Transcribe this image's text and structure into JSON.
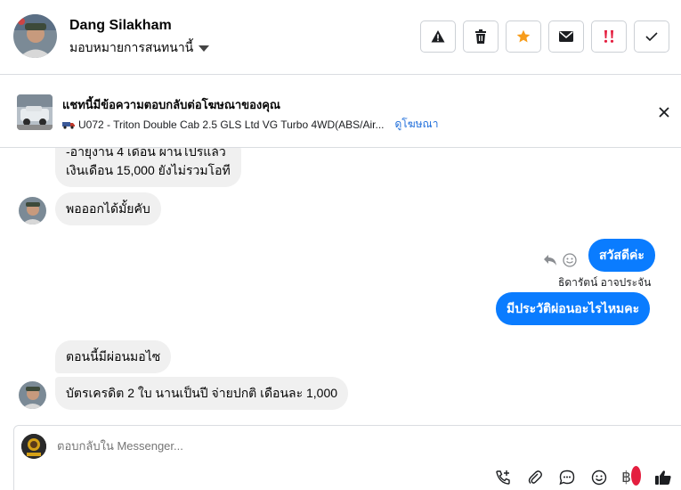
{
  "header": {
    "contact_name": "Dang Silakham",
    "assign_label": "มอบหมายการสนทนานี้",
    "tools": [
      "warning-icon",
      "trash-icon",
      "star-icon",
      "mail-icon",
      "double-exclamation-icon",
      "check-icon"
    ],
    "star_color": "#f79c1b",
    "exclaim_color": "#e41e3f"
  },
  "ad_reply": {
    "title": "แชทนี้มีข้อความตอบกลับต่อโฆษณาของคุณ",
    "ad_text": "U072 - Triton Double Cab 2.5 GLS Ltd VG Turbo 4WD(ABS/Air...",
    "view_ad": "ดูโฆษณา"
  },
  "messages": {
    "m1_line1": "-อายุงาน 4 เดือน  ผ่านโปรแล้ว",
    "m1_line2": "เงินเดือน 15,000 ยังไม่รวมโอที",
    "m2": "พอออกได้มั้ยคับ",
    "m3": "สวัสดีค่ะ",
    "sender": "ธิดารัตน์ อาจประจัน",
    "m4": "มีประวัติผ่อนอะไรไหมคะ",
    "m5": "ตอนนี้มีผ่อนมอไซ",
    "m6": "บัตรเครดิต 2 ใบ นานเป็นปี จ่ายปกติ เดือนละ 1,000"
  },
  "composer": {
    "placeholder": "ตอบกลับใน Messenger...",
    "actions": [
      "phone-plus-icon",
      "paperclip-icon",
      "chat-bubble-icon",
      "emoji-icon",
      "baht-icon",
      "thumbs-up-icon"
    ],
    "baht_symbol": "฿"
  },
  "colors": {
    "outgoing": "#0a7cff",
    "incoming": "#f0f0f0",
    "link": "#216fdb"
  }
}
